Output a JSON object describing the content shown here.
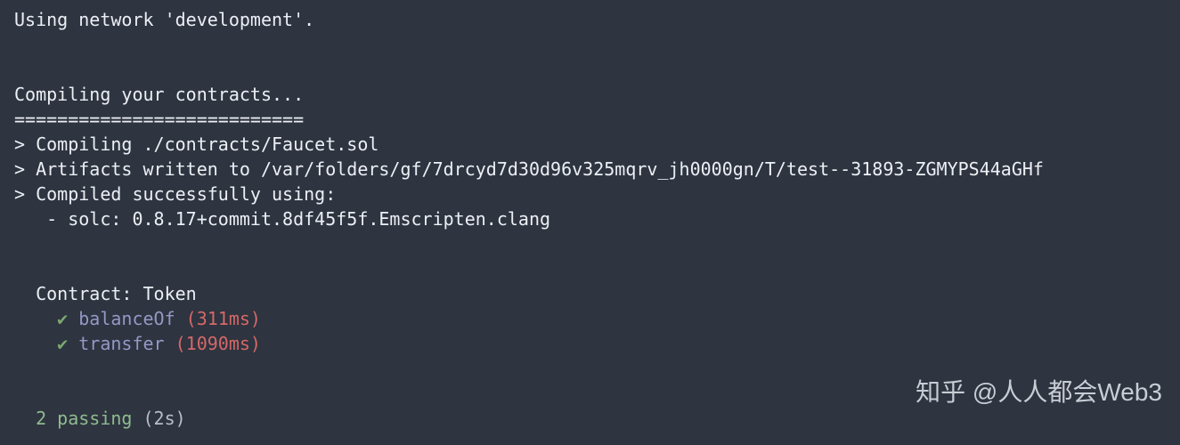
{
  "terminal": {
    "network_line": "Using network 'development'.",
    "compile_header": "Compiling your contracts...",
    "divider": "===========================",
    "compile_lines": [
      "> Compiling ./contracts/Faucet.sol",
      "> Artifacts written to /var/folders/gf/7drcyd7d30d96v325mqrv_jh0000gn/T/test--31893-ZGMYPS44aGHf",
      "> Compiled successfully using:",
      "   - solc: 0.8.17+commit.8df45f5f.Emscripten.clang"
    ],
    "contract_header": "  Contract: Token",
    "tests": [
      {
        "check": "    ✔",
        "name": " balanceOf",
        "time": " (311ms)"
      },
      {
        "check": "    ✔",
        "name": " transfer",
        "time": " (1090ms)"
      }
    ],
    "summary": {
      "count": "  2",
      "passing": " passing",
      "duration": " (2s)"
    }
  },
  "watermark": "知乎 @人人都会Web3"
}
